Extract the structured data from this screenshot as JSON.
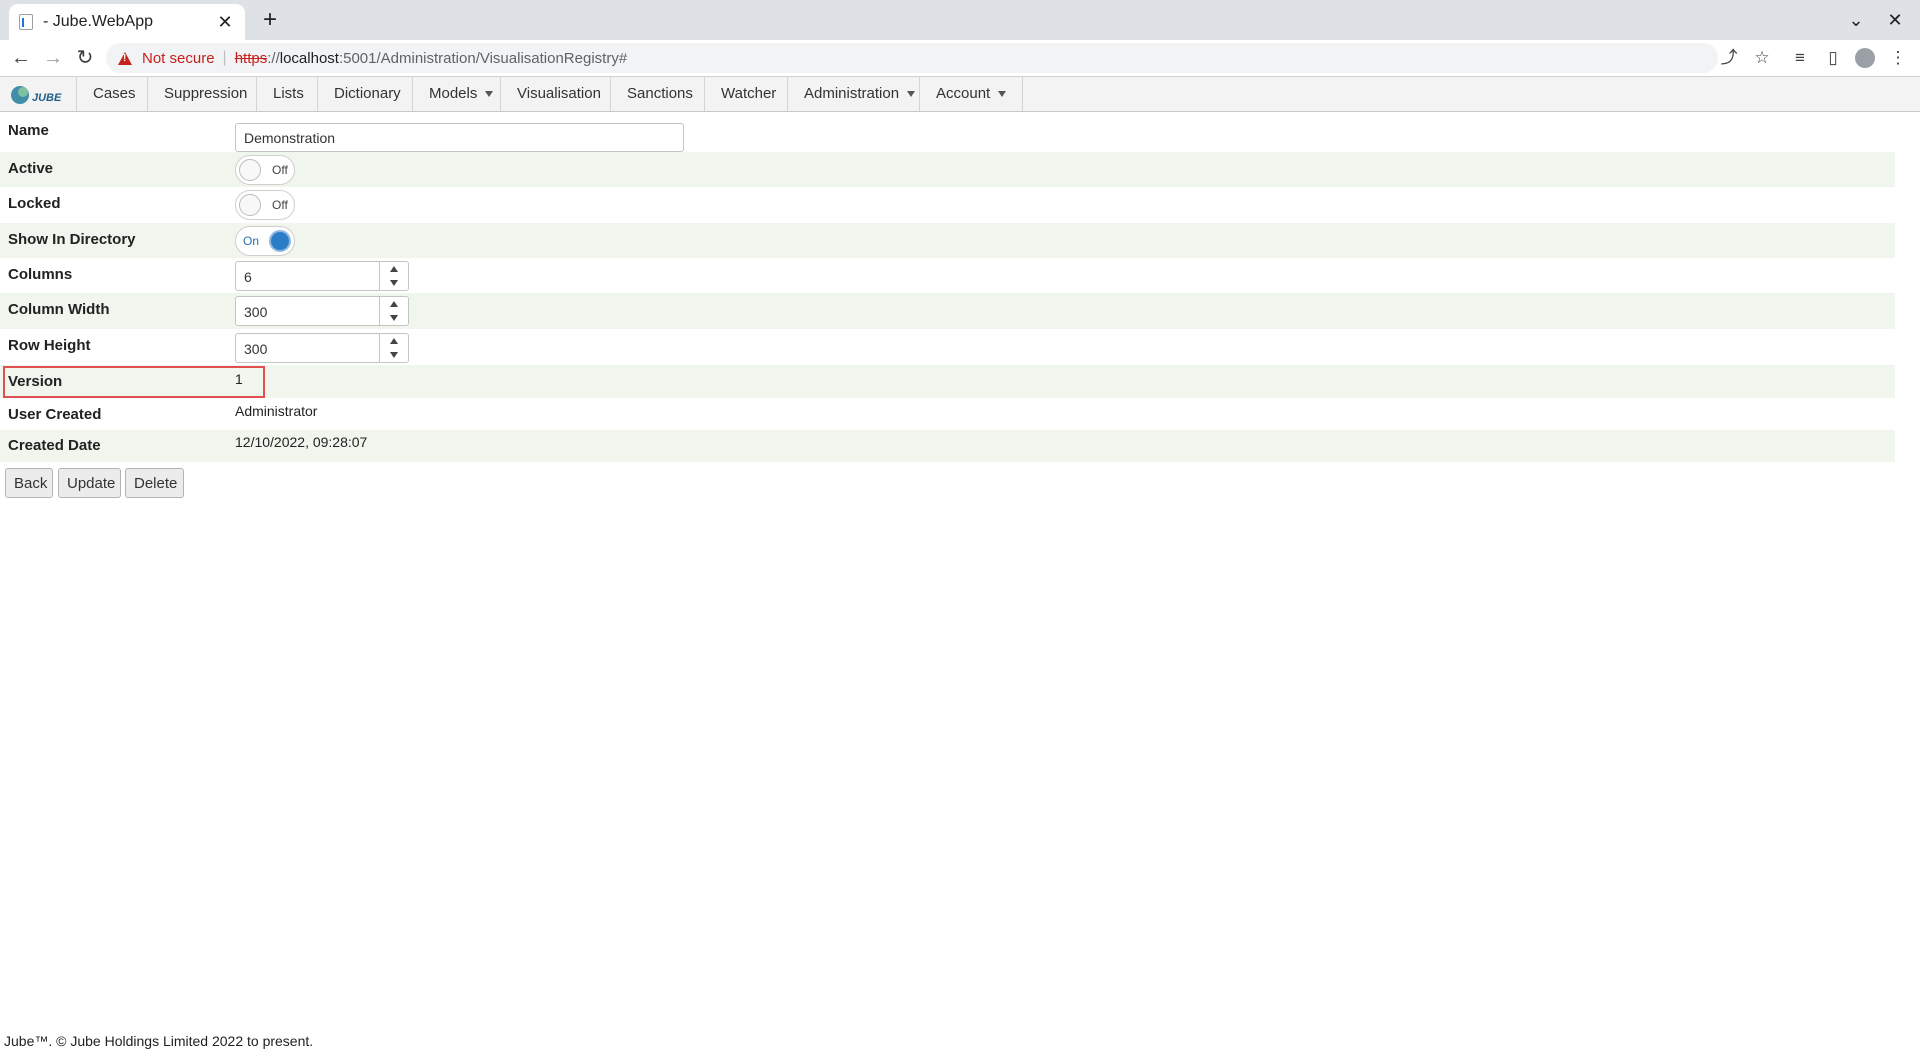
{
  "browser": {
    "tab_title": "- Jube.WebApp",
    "not_secure": "Not secure",
    "url_scheme": "https",
    "url_sep": "://",
    "url_host": "localhost",
    "url_rest": ":5001/Administration/VisualisationRegistry#"
  },
  "menu": {
    "items": [
      "Cases",
      "Suppression",
      "Lists",
      "Dictionary",
      "Models",
      "Visualisation",
      "Sanctions",
      "Watcher",
      "Administration",
      "Account"
    ],
    "logo_text": "JUBE"
  },
  "form": {
    "name_label": "Name",
    "name_value": "Demonstration",
    "active_label": "Active",
    "active_state": "Off",
    "locked_label": "Locked",
    "locked_state": "Off",
    "show_in_directory_label": "Show In Directory",
    "show_in_directory_state": "On",
    "columns_label": "Columns",
    "columns_value": "6",
    "column_width_label": "Column Width",
    "column_width_value": "300",
    "row_height_label": "Row Height",
    "row_height_value": "300",
    "version_label": "Version",
    "version_value": "1",
    "user_created_label": "User Created",
    "user_created_value": "Administrator",
    "created_date_label": "Created Date",
    "created_date_value": "12/10/2022, 09:28:07"
  },
  "actions": {
    "back": "Back",
    "update": "Update",
    "delete": "Delete"
  },
  "footer": "Jube™. © Jube Holdings Limited 2022 to present.",
  "colors": {
    "toggle_on": "#2a7dc6",
    "row_alt": "#f0f5ee",
    "highlight": "#e05050"
  }
}
